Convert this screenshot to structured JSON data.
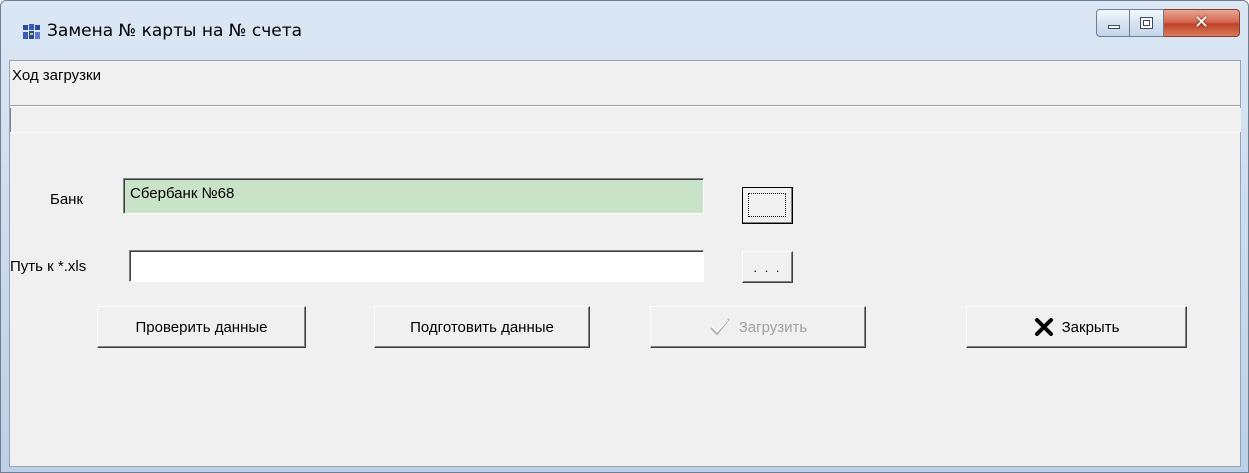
{
  "window": {
    "title": "Замена № карты на № счета",
    "icons": {
      "app": "app-icon",
      "minimize": "minimize-icon",
      "maximize": "maximize-icon",
      "close": "close-icon"
    }
  },
  "progress": {
    "label": "Ход загрузки",
    "value_percent": 0
  },
  "form": {
    "bank_label": "Банк",
    "bank_value": "Сбербанк №68",
    "path_label": "Путь к *.xls",
    "path_value": "",
    "bank_browse_label": ". . . . .",
    "path_browse_label": ". . ."
  },
  "buttons": {
    "check": "Проверить данные",
    "prepare": "Подготовить данные",
    "load": "Загрузить",
    "close": "Закрыть"
  },
  "colors": {
    "bank_field_bg": "#c8e3c8",
    "close_icon": "#000000",
    "disabled_text": "#a0a0a0"
  }
}
